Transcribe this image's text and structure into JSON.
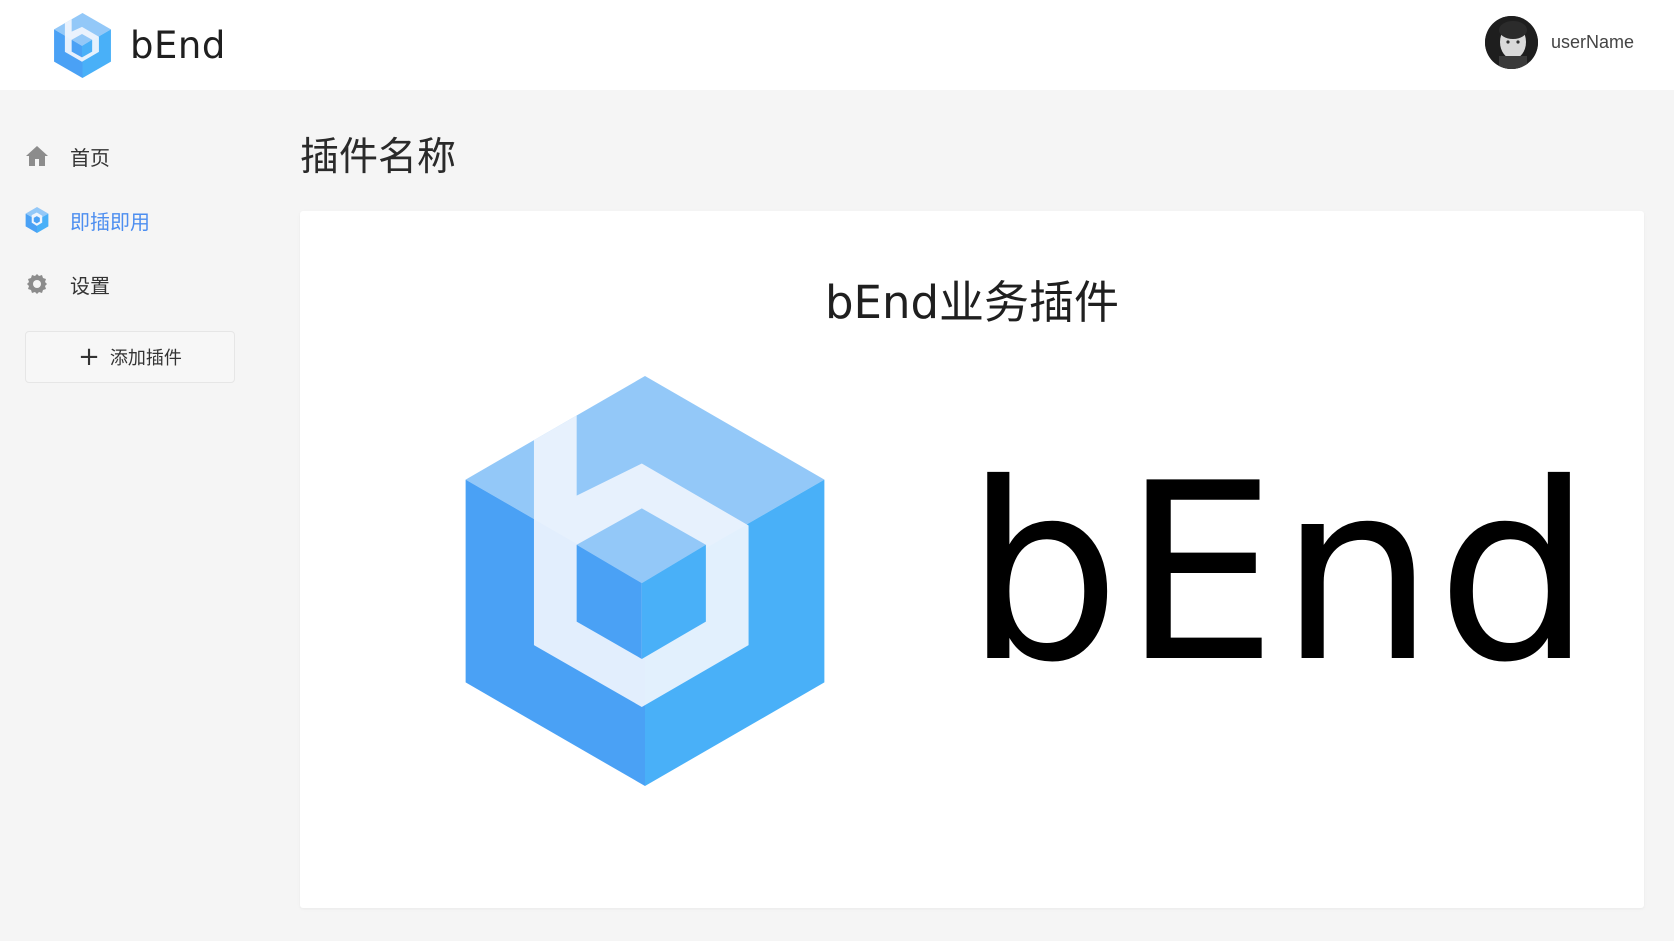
{
  "header": {
    "brand_name": "bEnd",
    "logo_icon": "bend-cube-logo",
    "user": {
      "name": "userName",
      "avatar_icon": "user-avatar"
    }
  },
  "sidebar": {
    "items": [
      {
        "label": "首页",
        "icon": "home-icon",
        "active": false
      },
      {
        "label": "即插即用",
        "icon": "plugin-cube-icon",
        "active": true
      },
      {
        "label": "设置",
        "icon": "gear-icon",
        "active": false
      }
    ],
    "add_button": {
      "label": "添加插件",
      "icon": "plus-icon"
    }
  },
  "main": {
    "page_title": "插件名称",
    "card": {
      "title": "bEnd业务插件",
      "wordmark": "bEnd"
    }
  },
  "colors": {
    "accent": "#4d8ef0",
    "cube_light": "#8ec5f7",
    "cube_mid": "#4aa3f5",
    "cube_dark": "#3e8ff2"
  }
}
